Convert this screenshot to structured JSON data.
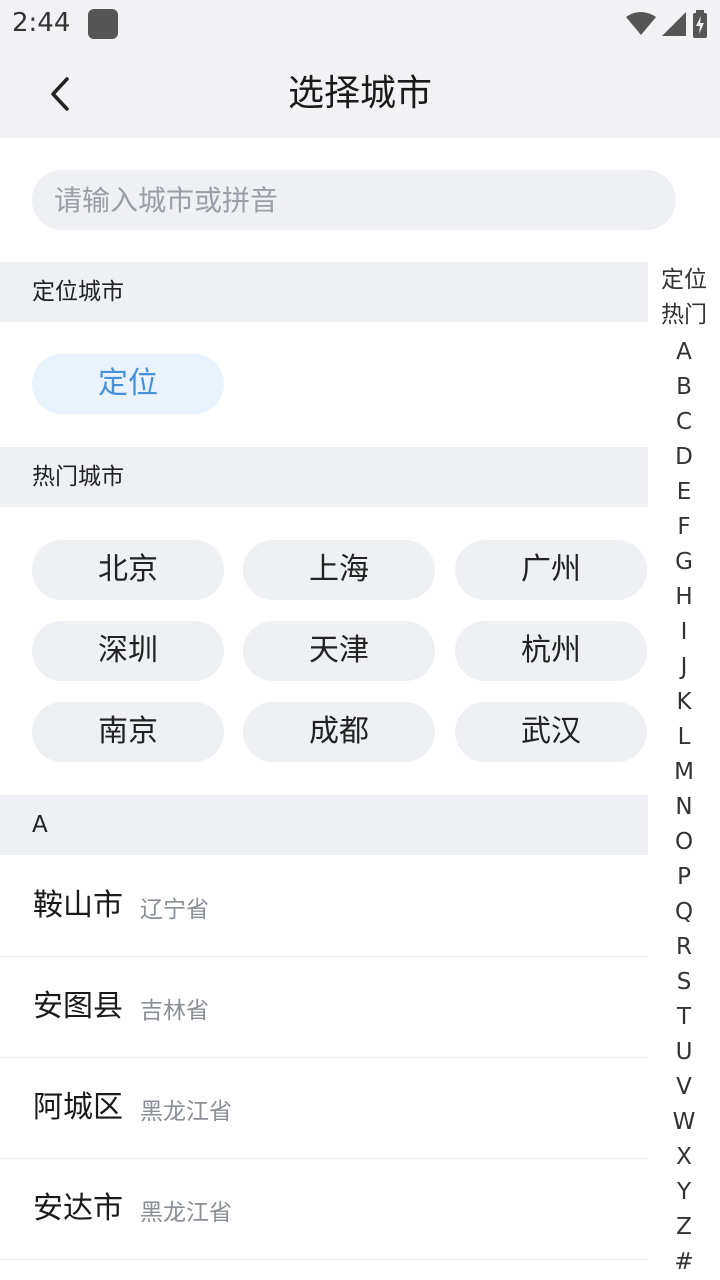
{
  "status_bar": {
    "time": "2:44"
  },
  "header": {
    "title": "选择城市"
  },
  "search": {
    "placeholder": "请输入城市或拼音"
  },
  "location": {
    "header": "定位城市",
    "button_label": "定位"
  },
  "hot": {
    "header": "热门城市",
    "cities": [
      "北京",
      "上海",
      "广州",
      "深圳",
      "天津",
      "杭州",
      "南京",
      "成都",
      "武汉"
    ]
  },
  "section_a": {
    "header": "A",
    "cities": [
      {
        "name": "鞍山市",
        "province": "辽宁省"
      },
      {
        "name": "安图县",
        "province": "吉林省"
      },
      {
        "name": "阿城区",
        "province": "黑龙江省"
      },
      {
        "name": "安达市",
        "province": "黑龙江省"
      }
    ]
  },
  "index_bar": [
    "定位",
    "热门",
    "A",
    "B",
    "C",
    "D",
    "E",
    "F",
    "G",
    "H",
    "I",
    "J",
    "K",
    "L",
    "M",
    "N",
    "O",
    "P",
    "Q",
    "R",
    "S",
    "T",
    "U",
    "V",
    "W",
    "X",
    "Y",
    "Z",
    "#"
  ]
}
